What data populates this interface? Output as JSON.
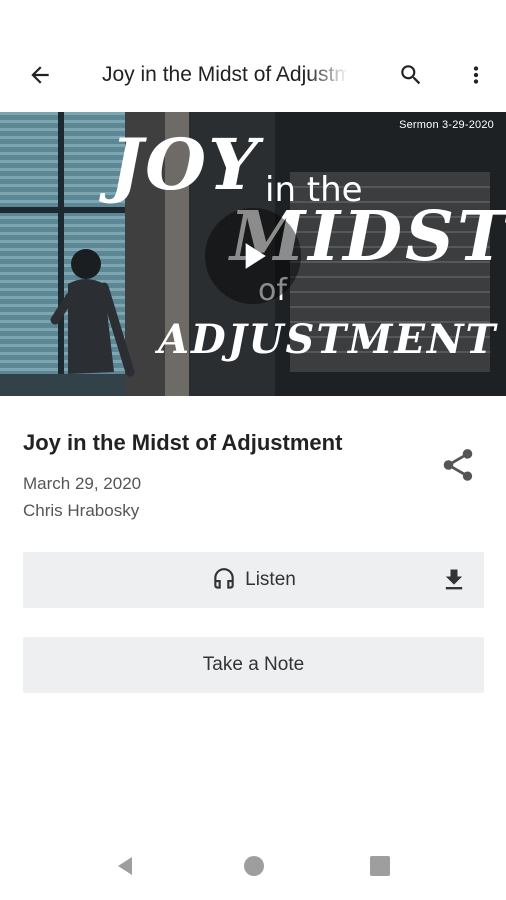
{
  "appbar": {
    "title": "Joy in the Midst of Adjustment",
    "icons": {
      "back": "back-arrow-icon",
      "search": "search-icon",
      "more": "more-vert-icon"
    }
  },
  "hero": {
    "sermon_tag": "Sermon 3-29-2020",
    "art_lines": {
      "joy": "JOY",
      "in_the": "in the",
      "midst": "MIDST",
      "of": "of",
      "adjustment": "ADJUSTMENT"
    },
    "play_icon": "play-icon"
  },
  "sermon": {
    "title": "Joy in the Midst of Adjustment",
    "date": "March 29, 2020",
    "speaker": "Chris Hrabosky",
    "share_icon": "share-icon"
  },
  "actions": {
    "listen_label": "Listen",
    "listen_icon": "headphones-icon",
    "download_icon": "download-icon",
    "note_label": "Take a Note"
  },
  "navbar": {
    "icons": [
      "nav-back-icon",
      "nav-home-icon",
      "nav-recents-icon"
    ]
  },
  "colors": {
    "button_bg": "#eeeff1",
    "text": "#222222",
    "muted": "#555555",
    "nav": "#9e9e9e"
  }
}
